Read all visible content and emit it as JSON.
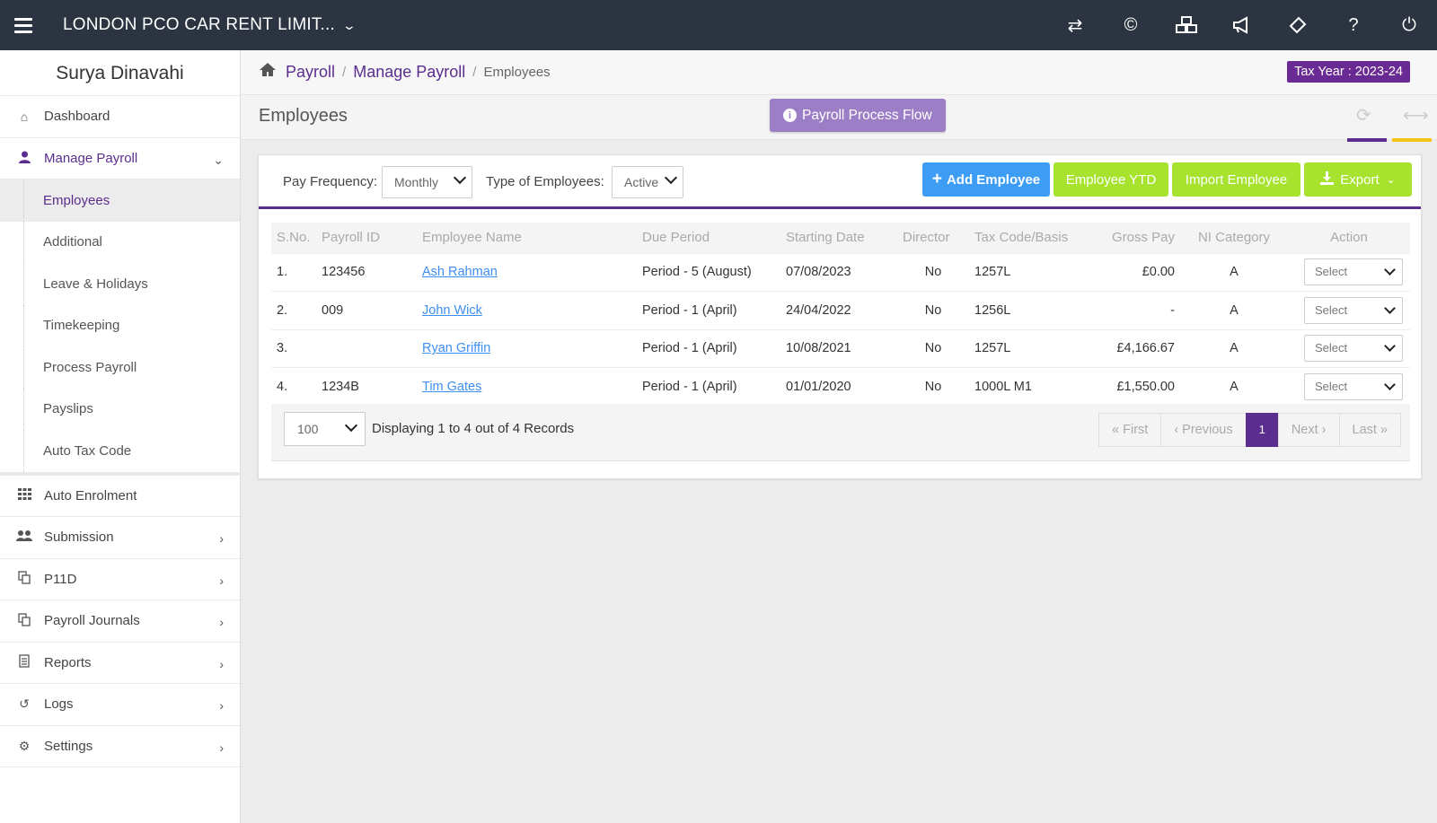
{
  "header": {
    "company": "LONDON PCO CAR RENT LIMIT...",
    "icons": [
      "transfer-icon",
      "copyright-icon",
      "cubes-icon",
      "megaphone-icon",
      "ticket-icon",
      "help-icon",
      "power-icon"
    ]
  },
  "sidebar": {
    "user_name": "Surya Dinavahi",
    "items": [
      {
        "label": "Dashboard",
        "icon": "home-icon"
      },
      {
        "label": "Manage Payroll",
        "icon": "user-icon"
      },
      {
        "label": "Auto Enrolment",
        "icon": "grid-icon"
      },
      {
        "label": "Submission",
        "icon": "users-icon"
      },
      {
        "label": "P11D",
        "icon": "copy-icon"
      },
      {
        "label": "Payroll Journals",
        "icon": "copy-icon"
      },
      {
        "label": "Reports",
        "icon": "document-icon"
      },
      {
        "label": "Logs",
        "icon": "history-icon"
      },
      {
        "label": "Settings",
        "icon": "gear-icon"
      }
    ],
    "submenu": [
      "Employees",
      "Additional",
      "Leave & Holidays",
      "Timekeeping",
      "Process Payroll",
      "Payslips",
      "Auto Tax Code"
    ]
  },
  "breadcrumb": {
    "items": [
      "Payroll",
      "Manage Payroll"
    ],
    "current": "Employees",
    "sep": "/"
  },
  "tax_year": "Tax Year : 2023-24",
  "page": {
    "title": "Employees",
    "process_flow_label": "Payroll Process Flow",
    "accent_purple": "#5b2d8e",
    "accent_yellow": "#f5c518"
  },
  "filters": {
    "pay_frequency_label": "Pay Frequency:",
    "pay_frequency_value": "Monthly",
    "type_label": "Type of Employees:",
    "type_value": "Active"
  },
  "actions": {
    "add": "Add Employee",
    "ytd": "Employee YTD",
    "import": "Import Employee",
    "export": "Export"
  },
  "table": {
    "columns": [
      "S.No.",
      "Payroll ID",
      "Employee Name",
      "Due Period",
      "Starting Date",
      "Director",
      "Tax Code/Basis",
      "Gross Pay",
      "NI Category",
      "Action"
    ],
    "rows": [
      {
        "sno": "1.",
        "payroll_id": "123456",
        "name": "Ash Rahman",
        "due": "Period - 5 (August)",
        "start": "07/08/2023",
        "director": "No",
        "tax": "1257L",
        "gross": "£0.00",
        "ni": "A",
        "action": "Select"
      },
      {
        "sno": "2.",
        "payroll_id": "009",
        "name": "John Wick",
        "due": "Period - 1 (April)",
        "start": "24/04/2022",
        "director": "No",
        "tax": "1256L",
        "gross": "-",
        "ni": "A",
        "action": "Select"
      },
      {
        "sno": "3.",
        "payroll_id": "",
        "name": "Ryan Griffin",
        "due": "Period - 1 (April)",
        "start": "10/08/2021",
        "director": "No",
        "tax": "1257L",
        "gross": "£4,166.67",
        "ni": "A",
        "action": "Select"
      },
      {
        "sno": "4.",
        "payroll_id": "1234B",
        "name": "Tim Gates",
        "due": "Period - 1 (April)",
        "start": "01/01/2020",
        "director": "No",
        "tax": "1000L M1",
        "gross": "£1,550.00",
        "ni": "A",
        "action": "Select"
      }
    ]
  },
  "pagination": {
    "page_size": "100",
    "info": "Displaying 1 to 4 out of 4 Records",
    "first": "« First",
    "previous": "‹ Previous",
    "current": "1",
    "next": "Next ›",
    "last": "Last »"
  }
}
